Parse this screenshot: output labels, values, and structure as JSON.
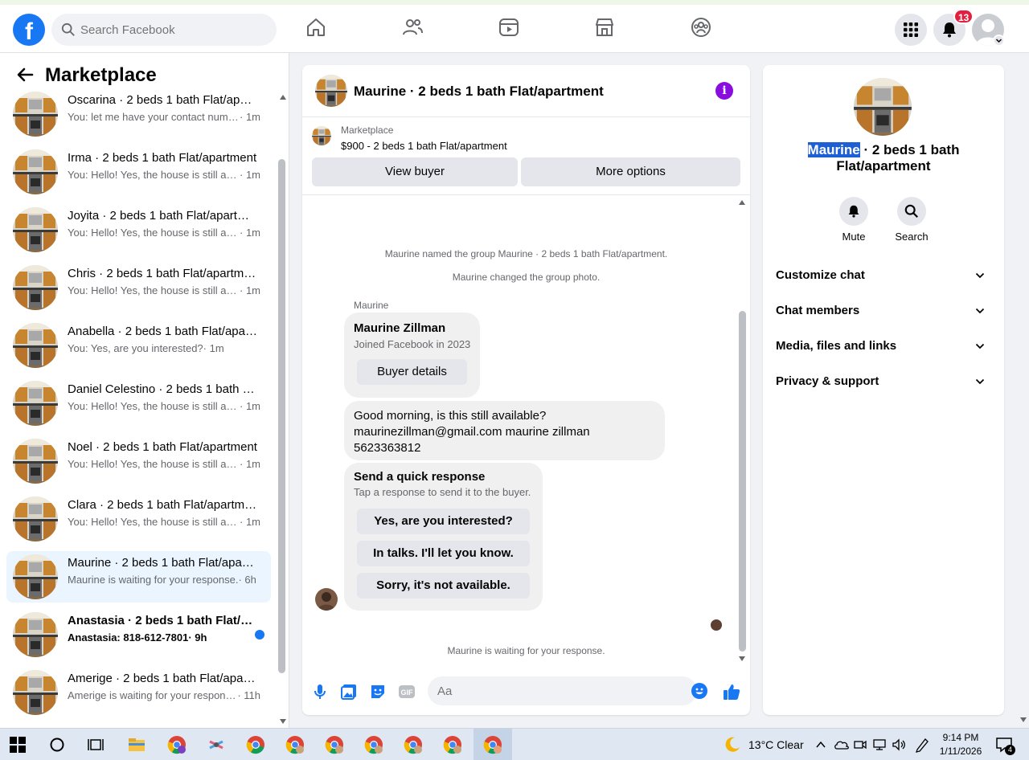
{
  "topnav": {
    "search_placeholder": "Search Facebook",
    "notification_count": "13"
  },
  "left": {
    "title": "Marketplace",
    "conversations": [
      {
        "name": "Oscarina · 2 beds 1 bath Flat/apartment",
        "preview": "You: let me have your contact number",
        "time": "· 1m"
      },
      {
        "name": "Irma · 2 beds 1 bath Flat/apartment",
        "preview": "You: Hello! Yes, the house is still available",
        "time": "· 1m"
      },
      {
        "name": "Joyita · 2 beds 1 bath Flat/apartment",
        "preview": "You: Hello! Yes, the house is still available",
        "time": "· 1m"
      },
      {
        "name": "Chris · 2 beds 1 bath Flat/apartment",
        "preview": "You: Hello! Yes, the house is still available",
        "time": "· 1m"
      },
      {
        "name": "Anabella · 2 beds 1 bath Flat/apartment",
        "preview": "You: Yes, are you interested?",
        "time": "· 1m"
      },
      {
        "name": "Daniel Celestino · 2 beds 1 bath Flat/apartment",
        "preview": "You: Hello! Yes, the house is still available",
        "time": "· 1m"
      },
      {
        "name": "Noel · 2 beds 1 bath Flat/apartment",
        "preview": "You: Hello! Yes, the house is still available",
        "time": "· 1m"
      },
      {
        "name": "Clara · 2 beds 1 bath Flat/apartment",
        "preview": "You: Hello! Yes, the house is still available",
        "time": "· 1m"
      },
      {
        "name": "Maurine · 2 beds 1 bath Flat/apartment",
        "preview": "Maurine is waiting for your response.",
        "time": " · 6h"
      },
      {
        "name": "Anastasia · 2 beds 1 bath Flat/apartment",
        "preview": "Anastasia: 818-612-7801",
        "time": " · 9h"
      },
      {
        "name": "Amerige · 2 beds 1 bath Flat/apartment",
        "preview": "Amerige is waiting for your response.",
        "time": " · 11h"
      }
    ]
  },
  "chat": {
    "header_title": "Maurine · 2 beds 1 bath Flat/apartment",
    "listing_source": "Marketplace",
    "listing_price": "$900 - 2 beds 1 bath Flat/apartment",
    "view_buyer": "View buyer",
    "more_options": "More options",
    "sys1": "Maurine named the group Maurine · 2 beds 1 bath Flat/apartment.",
    "sys2": "Maurine changed the group photo.",
    "sender": "Maurine",
    "card_name": "Maurine Zillman",
    "card_joined": "Joined Facebook in 2023",
    "buyer_details": "Buyer details",
    "msg_line1": "Good morning, is this still available?",
    "msg_line2": "maurinezillman@gmail.com maurine zillman",
    "msg_line3": "5623363812",
    "quick_title": "Send a quick response",
    "quick_sub": "Tap a response to send it to the buyer.",
    "quick1": "Yes, are you interested?",
    "quick2": "In talks. I'll let you know.",
    "quick3": "Sorry, it's not available.",
    "waiting": "Maurine is waiting for your response.",
    "input_placeholder": "Aa"
  },
  "right": {
    "title_highlight": "Maurine",
    "title_rest": " · 2 beds 1 bath Flat/apartment",
    "mute": "Mute",
    "search": "Search",
    "sections": [
      "Customize chat",
      "Chat members",
      "Media, files and links",
      "Privacy & support"
    ]
  },
  "taskbar": {
    "weather": "13°C  Clear",
    "time": "9:14 PM",
    "date": "1/11/2026",
    "action_center_count": "4"
  }
}
